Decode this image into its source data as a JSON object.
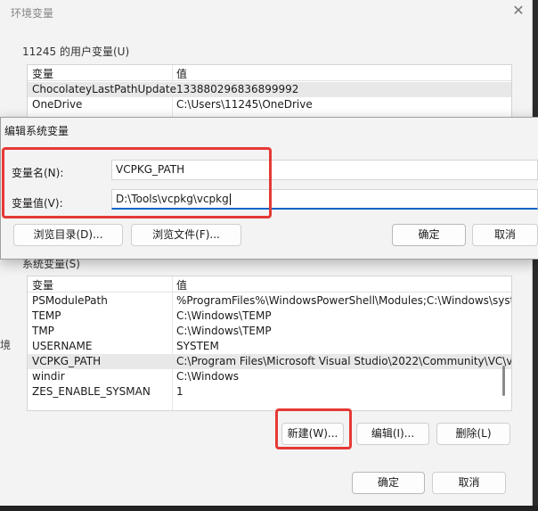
{
  "env_window": {
    "title": "环境变量",
    "user_section_label": "11245 的用户变量(U)",
    "columns": {
      "name": "变量",
      "value": "值"
    },
    "user_rows": [
      {
        "name": "ChocolateyLastPathUpdate",
        "value": "133880296836899992"
      },
      {
        "name": "OneDrive",
        "value": "C:\\Users\\11245\\OneDrive"
      }
    ],
    "system_section_label": "系统变量(S)",
    "system_rows": [
      {
        "name": "PSModulePath",
        "value": "%ProgramFiles%\\WindowsPowerShell\\Modules;C:\\Windows\\syste..."
      },
      {
        "name": "TEMP",
        "value": "C:\\Windows\\TEMP"
      },
      {
        "name": "TMP",
        "value": "C:\\Windows\\TEMP"
      },
      {
        "name": "USERNAME",
        "value": "SYSTEM"
      },
      {
        "name": "VCPKG_PATH",
        "value": "C:\\Program Files\\Microsoft Visual Studio\\2022\\Community\\VC\\vc..."
      },
      {
        "name": "windir",
        "value": "C:\\Windows"
      },
      {
        "name": "ZES_ENABLE_SYSMAN",
        "value": "1"
      }
    ],
    "buttons": {
      "new": "新建(W)...",
      "edit": "编辑(I)...",
      "delete": "删除(L)",
      "ok": "确定",
      "cancel": "取消"
    },
    "left_edge_char": "境"
  },
  "dialog": {
    "title": "编辑系统变量",
    "name_label": "变量名(N):",
    "name_value": "VCPKG_PATH",
    "value_label": "变量值(V):",
    "value_value": "D:\\Tools\\vcpkg\\vcpkg",
    "buttons": {
      "browse_dir": "浏览目录(D)...",
      "browse_file": "浏览文件(F)...",
      "ok": "确定",
      "cancel": "取消"
    }
  },
  "colors": {
    "highlight_red": "#e53935",
    "focus_blue": "#0a64c8"
  }
}
